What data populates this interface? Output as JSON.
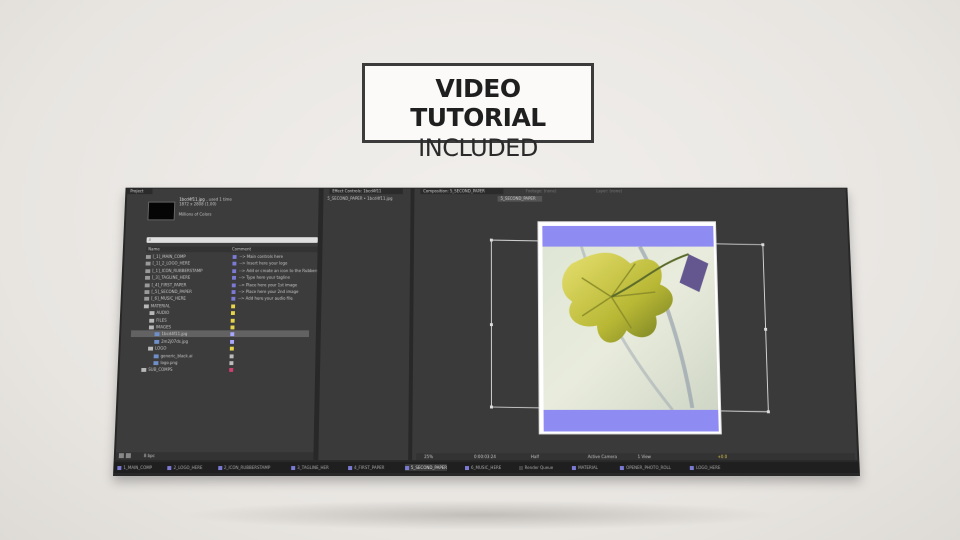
{
  "headline": {
    "line1": "VIDEO TUTORIAL",
    "line2": "INCLUDED"
  },
  "app": {
    "project_panel": {
      "tab": "Project",
      "selected_file": "1bcd4f11.jpg",
      "used_count": ", used 1 time",
      "dimensions": "1872 x 2808 (1.00)",
      "colors": "Millions of Colors",
      "columns": {
        "name": "Name",
        "comment": "Comment"
      },
      "items": [
        {
          "indent": 0,
          "type": "comp",
          "name": "[_1]_MAIN_COMP",
          "comment": "--> Main controls here",
          "color": "#7b7bd6"
        },
        {
          "indent": 0,
          "type": "comp",
          "name": "[_1]_2_LOGO_HERE",
          "comment": "--> Insert here your logo",
          "color": "#7b7bd6"
        },
        {
          "indent": 0,
          "type": "comp",
          "name": "[_1]_ICON_RUBBERSTAMP",
          "comment": "--> Add or create an icon to the Rubberstamp",
          "color": "#7b7bd6"
        },
        {
          "indent": 0,
          "type": "comp",
          "name": "[_3]_TAGLINE_HERE",
          "comment": "--> Type here your tagline",
          "color": "#7b7bd6"
        },
        {
          "indent": 0,
          "type": "comp",
          "name": "[_4]_FIRST_PAPER",
          "comment": "--> Place here your 1st image",
          "color": "#7b7bd6"
        },
        {
          "indent": 0,
          "type": "comp",
          "name": "[_5]_SECOND_PAPER",
          "comment": "--> Place here your 2nd image",
          "color": "#7b7bd6"
        },
        {
          "indent": 0,
          "type": "comp",
          "name": "[_6]_MUSIC_HERE",
          "comment": "--> Add here your audio file",
          "color": "#7b7bd6"
        },
        {
          "indent": 0,
          "type": "folder",
          "name": "MATERIAL",
          "comment": "",
          "color": "#e6d44a"
        },
        {
          "indent": 1,
          "type": "folder",
          "name": "AUDIO",
          "comment": "",
          "color": "#e6d44a"
        },
        {
          "indent": 1,
          "type": "folder",
          "name": "FILES",
          "comment": "",
          "color": "#e6d44a"
        },
        {
          "indent": 1,
          "type": "folder",
          "name": "IMAGES",
          "comment": "",
          "color": "#e6d44a"
        },
        {
          "indent": 2,
          "type": "file",
          "name": "1bcd4f11.jpg",
          "comment": "",
          "color": "#a8a8ff",
          "selected": true
        },
        {
          "indent": 2,
          "type": "file",
          "name": "2m2j07ds.jpg",
          "comment": "",
          "color": "#a8a8ff"
        },
        {
          "indent": 1,
          "type": "folder",
          "name": "LOGO",
          "comment": "",
          "color": "#e6d44a"
        },
        {
          "indent": 2,
          "type": "file",
          "name": "generic_black.ai",
          "comment": "",
          "color": "#bdbdbd"
        },
        {
          "indent": 2,
          "type": "file",
          "name": "logo.png",
          "comment": "",
          "color": "#bdbdbd"
        },
        {
          "indent": 0,
          "type": "folder",
          "name": "SUB_COMPS",
          "comment": "",
          "color": "#d04070"
        }
      ],
      "footer_bpc": "8 bpc"
    },
    "effect_panel": {
      "tab": "Effect Controls: 1bcd4f11",
      "breadcrumb": "5_SECOND_PAPER • 1bcd4f11.jpg"
    },
    "comp_panel": {
      "tab": "Composition: 5_SECOND_PAPER",
      "tab2": "Footage: (none)",
      "tab3": "Layer: (none)",
      "subtab": "5_SECOND_PAPER",
      "zoom": "25%",
      "timecode": "0:00:03:24",
      "resolution": "Half",
      "camera": "Active Camera",
      "views": "1 View",
      "exposure": "+0.0"
    },
    "timeline_tabs": [
      {
        "label": "1_MAIN_COMP",
        "color": "#7b7bd6"
      },
      {
        "label": "2_LOGO_HERE",
        "color": "#7b7bd6"
      },
      {
        "label": "2_ICON_RUBBERSTAMP",
        "color": "#7b7bd6"
      },
      {
        "label": "3_TAGLINE_HER",
        "color": "#7b7bd6"
      },
      {
        "label": "4_FIRST_PAPER",
        "color": "#7b7bd6"
      },
      {
        "label": "5_SECOND_PAPER",
        "color": "#7b7bd6",
        "active": true
      },
      {
        "label": "6_MUSIC_HERE",
        "color": "#7b7bd6"
      },
      {
        "label": "Render Queue",
        "color": "#444444"
      },
      {
        "label": "MATERIAL",
        "color": "#7b7bd6"
      },
      {
        "label": "OPENER_PHOTO_ROLL",
        "color": "#7b7bd6"
      },
      {
        "label": "LOGO_HERE",
        "color": "#7b7bd6"
      }
    ]
  }
}
